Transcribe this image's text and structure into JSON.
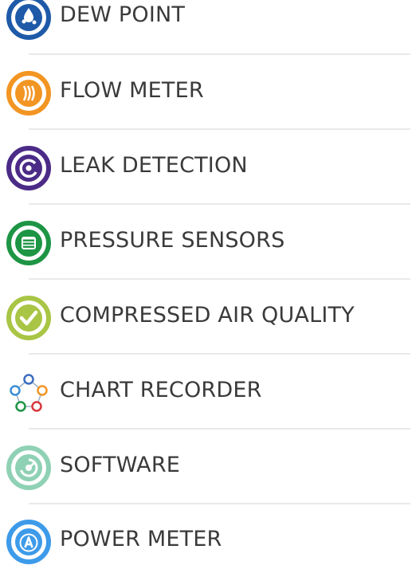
{
  "menu": {
    "items": [
      {
        "label": "DEW POINT",
        "icon": "dew-point-icon",
        "color": "#1e5aa8"
      },
      {
        "label": "FLOW METER",
        "icon": "flow-meter-icon",
        "color": "#f29522"
      },
      {
        "label": "LEAK DETECTION",
        "icon": "leak-detection-icon",
        "color": "#4b2b87"
      },
      {
        "label": "PRESSURE SENSORS",
        "icon": "pressure-sensors-icon",
        "color": "#1d9545"
      },
      {
        "label": "COMPRESSED AIR QUALITY",
        "icon": "air-quality-icon",
        "color": "#a9c545"
      },
      {
        "label": "CHART RECORDER",
        "icon": "chart-recorder-icon",
        "color": "#3b8fd6"
      },
      {
        "label": "SOFTWARE",
        "icon": "software-icon",
        "color": "#8fd1b4"
      },
      {
        "label": "POWER METER",
        "icon": "power-meter-icon",
        "color": "#3d9be9"
      }
    ]
  }
}
